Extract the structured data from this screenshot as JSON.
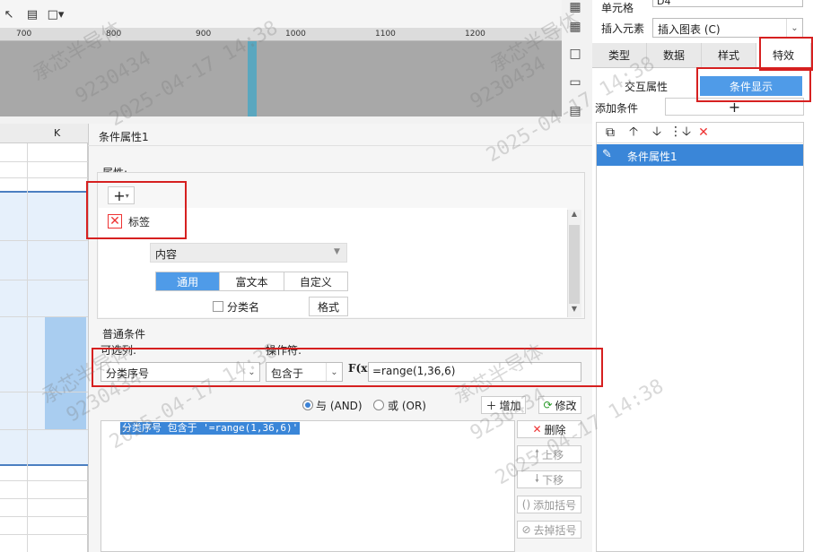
{
  "ruler": {
    "ticks": [
      "700",
      "800",
      "900",
      "1000",
      "1100",
      "1200"
    ]
  },
  "sheet": {
    "column_header": "K"
  },
  "dialog": {
    "title": "条件属性1",
    "properties_label": "属性:",
    "add_button_label": "+",
    "tag_label": "标签",
    "content_select": "内容",
    "subtabs": [
      "通用",
      "富文本",
      "自定义"
    ],
    "category_checkbox_label": "分类名",
    "format_button": "格式",
    "conditions_title": "普通条件",
    "column_label": "可选列:",
    "operator_label": "操作符:",
    "column_value": "分类序号",
    "operator_value": "包含于",
    "fx_label": "F(x)",
    "range_value": "=range(1,36,6)",
    "radio_and": "与 (AND)",
    "radio_or": "或 (OR)",
    "add_label": "增加",
    "modify_label": "修改",
    "delete_label": "删除",
    "move_up_label": "上移",
    "move_down_label": "下移",
    "add_paren_label": "添加括号",
    "remove_paren_label": "去掉括号",
    "condition_item": "分类序号 包含于 '=range(1,36,6)'"
  },
  "right_panel": {
    "cell_label": "单元格",
    "cell_value": "D4",
    "insert_label": "插入元素",
    "insert_value": "插入图表 (C)",
    "tabs": [
      "类型",
      "数据",
      "样式",
      "特效"
    ],
    "active_tab": "特效",
    "subtab_interaction": "交互属性",
    "subtab_condition": "条件显示",
    "add_condition_label": "添加条件",
    "add_condition_button": "+",
    "list_item": "条件属性1"
  },
  "watermark": {
    "company": "承芯半导体",
    "id": "9230434",
    "datetime": "2025-04-17 14:38"
  },
  "colors": {
    "accent": "#4f9be8",
    "highlight": "#d62020",
    "selection": "#3a86d8"
  }
}
